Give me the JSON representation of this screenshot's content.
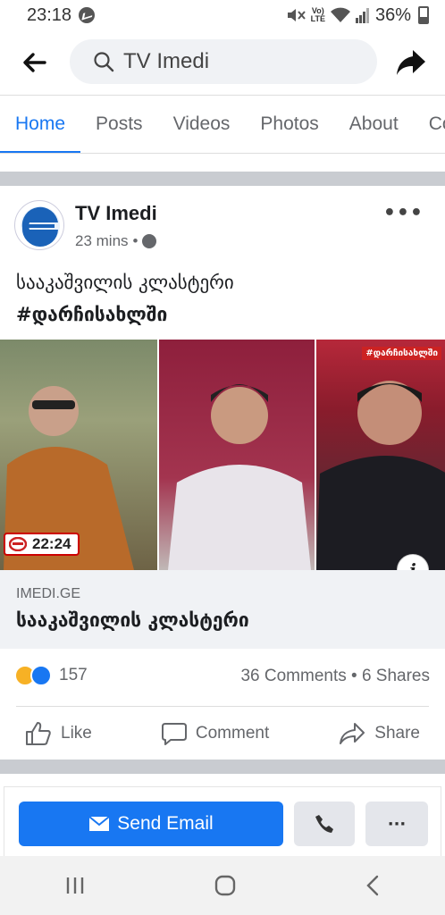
{
  "status_bar": {
    "time": "23:18",
    "volte": "Vo)\nLTE",
    "battery": "36%",
    "icons": [
      "messenger-icon",
      "mute-icon",
      "wifi-icon",
      "signal-icon",
      "battery-icon"
    ]
  },
  "search": {
    "value": "TV Imedi"
  },
  "tabs": [
    "Home",
    "Posts",
    "Videos",
    "Photos",
    "About",
    "Co"
  ],
  "active_tab": "Home",
  "post": {
    "page_name": "TV Imedi",
    "time": "23 mins",
    "separator": "•",
    "text_line1": "სააკაშვილის კლასტერი",
    "text_line2": "#დარჩისახლში",
    "media": {
      "time_badge": "22:24",
      "hashtag": "#დარჩისახლში"
    },
    "link": {
      "domain": "IMEDI.GE",
      "title": "სააკაშვილის კლასტერი"
    },
    "stats": {
      "reactions_count": "157",
      "comments_shares": "36 Comments • 6 Shares"
    },
    "actions": {
      "like": "Like",
      "comment": "Comment",
      "share": "Share"
    }
  },
  "cta": {
    "send_email": "Send Email",
    "more": "···"
  },
  "colors": {
    "accent": "#1877f2",
    "text_muted": "#65676b",
    "divider": "#c9ccd1"
  }
}
